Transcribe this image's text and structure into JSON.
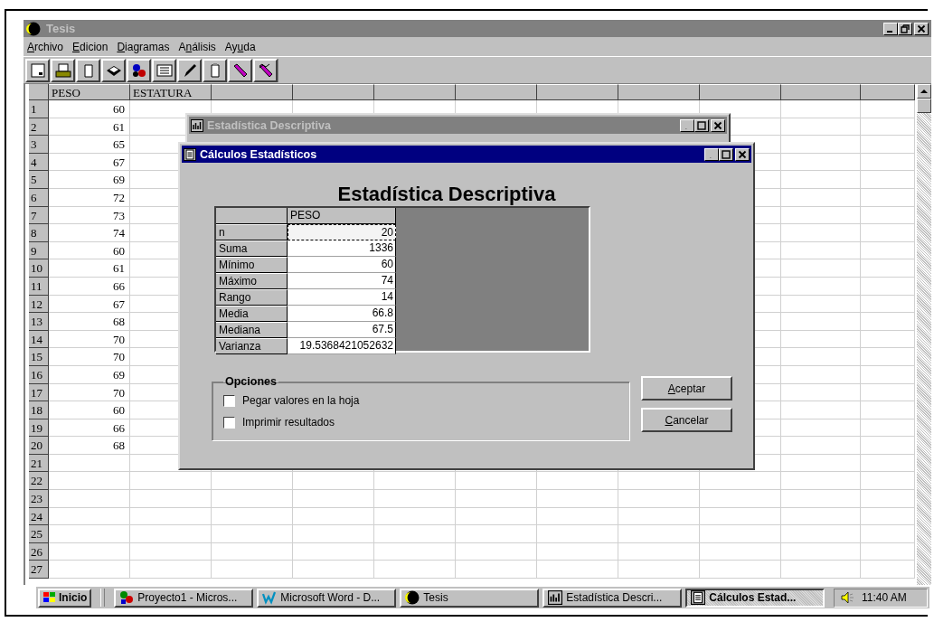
{
  "window": {
    "title": "Tesis",
    "active": false
  },
  "menu": [
    {
      "key": "A",
      "post": "rchivo"
    },
    {
      "key": "E",
      "post": "dicion"
    },
    {
      "key": "D",
      "post": "iagramas"
    },
    {
      "pre": "A",
      "key": "n",
      "post": "álisis"
    },
    {
      "pre": "Ay",
      "key": "u",
      "post": "da"
    }
  ],
  "sheet": {
    "columns": [
      "PESO",
      "ESTATURA"
    ],
    "rows": [
      {
        "number": "1",
        "cells": [
          "60"
        ]
      },
      {
        "number": "2",
        "cells": [
          "61"
        ]
      },
      {
        "number": "3",
        "cells": [
          "65"
        ]
      },
      {
        "number": "4",
        "cells": [
          "67"
        ]
      },
      {
        "number": "5",
        "cells": [
          "69"
        ]
      },
      {
        "number": "6",
        "cells": [
          "72"
        ]
      },
      {
        "number": "7",
        "cells": [
          "73"
        ]
      },
      {
        "number": "8",
        "cells": [
          "74"
        ]
      },
      {
        "number": "9",
        "cells": [
          "60"
        ]
      },
      {
        "number": "10",
        "cells": [
          "61"
        ]
      },
      {
        "number": "11",
        "cells": [
          "66"
        ]
      },
      {
        "number": "12",
        "cells": [
          "67"
        ]
      },
      {
        "number": "13",
        "cells": [
          "68"
        ]
      },
      {
        "number": "14",
        "cells": [
          "70"
        ]
      },
      {
        "number": "15",
        "cells": [
          "70"
        ]
      },
      {
        "number": "16",
        "cells": [
          "69"
        ]
      },
      {
        "number": "17",
        "cells": [
          "70"
        ]
      },
      {
        "number": "18",
        "cells": [
          "60"
        ]
      },
      {
        "number": "19",
        "cells": [
          "66"
        ]
      },
      {
        "number": "20",
        "cells": [
          "68"
        ]
      },
      {
        "number": "21",
        "cells": []
      },
      {
        "number": "22",
        "cells": []
      },
      {
        "number": "23",
        "cells": []
      },
      {
        "number": "24",
        "cells": []
      },
      {
        "number": "25",
        "cells": []
      },
      {
        "number": "26",
        "cells": []
      },
      {
        "number": "27",
        "cells": []
      }
    ]
  },
  "back_window": {
    "title": "Estadística Descriptiva",
    "active": false
  },
  "dialog": {
    "title": "Cálculos Estadísticos",
    "active": true,
    "heading": "Estadística Descriptiva",
    "stats": {
      "column": "PESO",
      "rows": [
        {
          "label": "n",
          "value": "20",
          "focused": true
        },
        {
          "label": "Suma",
          "value": "1336",
          "focused": false
        },
        {
          "label": "Mínimo",
          "value": "60",
          "focused": false
        },
        {
          "label": "Máximo",
          "value": "74",
          "focused": false
        },
        {
          "label": "Rango",
          "value": "14",
          "focused": false
        },
        {
          "label": "Media",
          "value": "66.8",
          "focused": false
        },
        {
          "label": "Mediana",
          "value": "67.5",
          "focused": false
        },
        {
          "label": "Varianza",
          "value": "19.5368421052632",
          "focused": false
        }
      ]
    },
    "options": {
      "title": "Opciones",
      "items": [
        {
          "label": "Pegar valores en la hoja",
          "checked": false
        },
        {
          "label": "Imprimir resultados",
          "checked": false
        }
      ]
    },
    "buttons": [
      {
        "key": "A",
        "post": "ceptar"
      },
      {
        "key": "C",
        "post": "ancelar"
      }
    ]
  },
  "taskbar": {
    "start": "Inicio",
    "items": [
      {
        "label": "Proyecto1 - Micros...",
        "kind": "program",
        "selected": false
      },
      {
        "label": "Microsoft Word - D...",
        "kind": "document",
        "selected": false
      },
      {
        "label": "Tesis",
        "kind": "moon",
        "selected": false
      },
      {
        "label": "Estadística Descri...",
        "kind": "chart",
        "selected": false
      },
      {
        "label": "Cálculos Estad...",
        "kind": "list",
        "selected": true
      }
    ],
    "clock": "11:40 AM"
  }
}
